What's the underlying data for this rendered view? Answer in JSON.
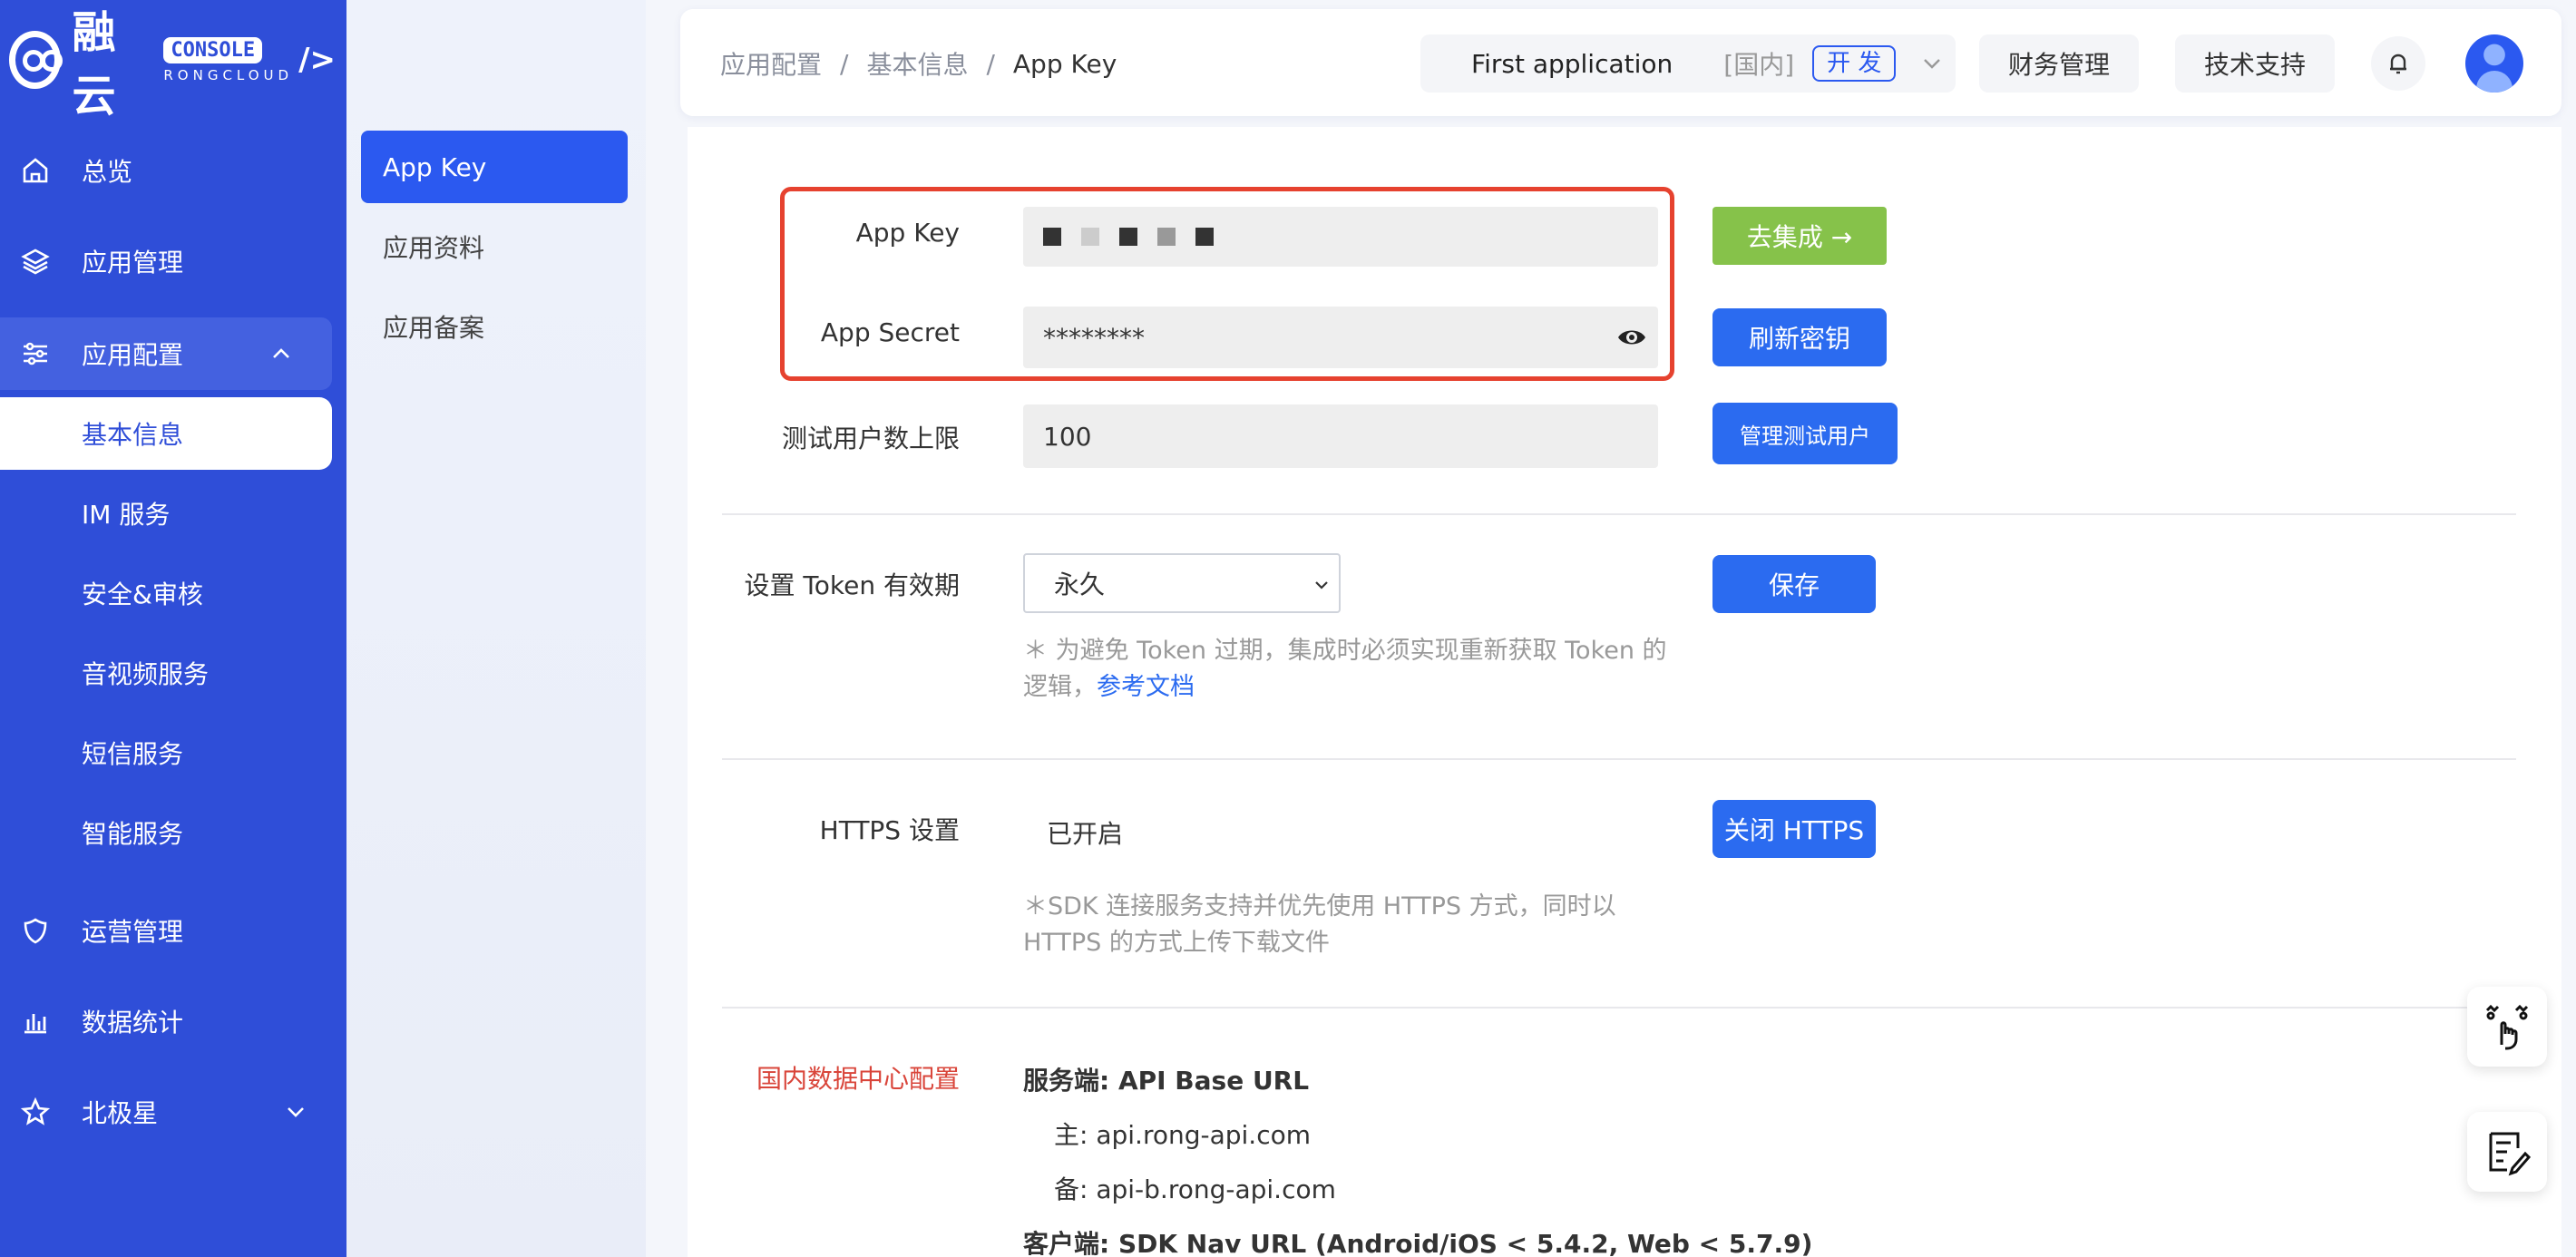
{
  "brand": {
    "name": "融云",
    "console_badge": "CONSOLE",
    "console_sub": "RONGCLOUD",
    "console_slash": "/>"
  },
  "sidebar": {
    "items": [
      {
        "label": "总览",
        "icon": "home-icon"
      },
      {
        "label": "应用管理",
        "icon": "layers-icon"
      },
      {
        "label": "应用配置",
        "icon": "sliders-icon"
      },
      {
        "label": "运营管理",
        "icon": "shield-icon"
      },
      {
        "label": "数据统计",
        "icon": "bar-chart-icon"
      },
      {
        "label": "北极星",
        "icon": "star-icon"
      }
    ],
    "sub_items": [
      {
        "label": "基本信息"
      },
      {
        "label": "IM 服务"
      },
      {
        "label": "安全&审核"
      },
      {
        "label": "音视频服务"
      },
      {
        "label": "短信服务"
      },
      {
        "label": "智能服务"
      }
    ]
  },
  "subnav": {
    "items": [
      {
        "label": "App Key"
      },
      {
        "label": "应用资料"
      },
      {
        "label": "应用备案"
      }
    ]
  },
  "header": {
    "breadcrumb": [
      "应用配置",
      "基本信息",
      "App Key"
    ],
    "separator": "/",
    "app_name": "First application",
    "region": "[国内]",
    "env": "开 发",
    "finance": "财务管理",
    "support": "技术支持"
  },
  "form": {
    "app_key_label": "App Key",
    "app_secret_label": "App Secret",
    "app_secret_value": "********",
    "go_integrate": "去集成 →",
    "refresh_secret": "刷新密钥",
    "test_users_label": "测试用户数上限",
    "test_users_value": "100",
    "manage_test_users": "管理测试用户",
    "token_label": "设置 Token 有效期",
    "token_value": "永久",
    "save": "保存",
    "token_note_1": "＊ 为避免 Token 过期，集成时必须实现重新获取 Token 的",
    "token_note_2": "逻辑，",
    "token_doc_link": "参考文档",
    "https_label": "HTTPS 设置",
    "https_status": "已开启",
    "https_close": "关闭 HTTPS",
    "https_note_1": "＊SDK 连接服务支持并优先使用 HTTPS 方式，同时以",
    "https_note_2": "HTTPS 的方式上传下载文件",
    "dc_label": "国内数据中心配置",
    "server_title": "服务端: API Base URL",
    "server_main": "主: api.rong-api.com",
    "server_backup": "备: api-b.rong-api.com",
    "client_title": "客户端: SDK Nav URL (Android/iOS < 5.4.2, Web < 5.7.9)"
  },
  "colors": {
    "sidebar": "#2f4ed8",
    "primary": "#2b6bf0",
    "green": "#86c24a",
    "highlight": "#e6422f",
    "dc_label": "#d9453a"
  }
}
